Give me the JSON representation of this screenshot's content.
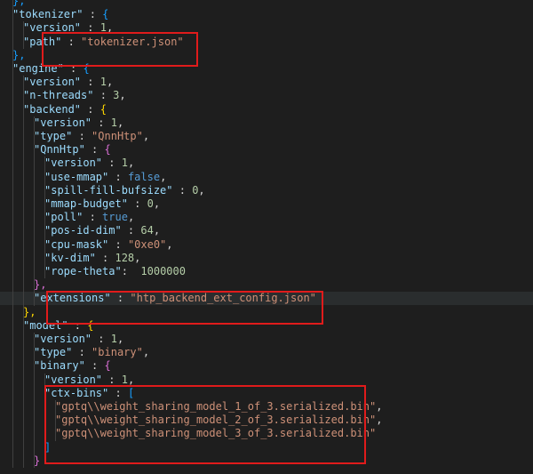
{
  "editor": {
    "lines": [
      {
        "indent": 2,
        "tokens": [
          [
            "p3",
            "},"
          ]
        ]
      },
      {
        "indent": 2,
        "tokens": [
          [
            "k",
            "\"tokenizer\""
          ],
          [
            "t",
            " : "
          ],
          [
            "p3",
            "{"
          ]
        ]
      },
      {
        "indent": 3,
        "tokens": [
          [
            "k",
            "\"version\""
          ],
          [
            "t",
            " : "
          ],
          [
            "n",
            "1"
          ],
          [
            "t",
            ","
          ]
        ]
      },
      {
        "indent": 3,
        "tokens": [
          [
            "k",
            "\"path\""
          ],
          [
            "t",
            " : "
          ],
          [
            "s",
            "\"tokenizer.json\""
          ]
        ]
      },
      {
        "indent": 2,
        "tokens": [
          [
            "p3",
            "},"
          ]
        ]
      },
      {
        "indent": 2,
        "tokens": [
          [
            "k",
            "\"engine\""
          ],
          [
            "t",
            " : "
          ],
          [
            "p3",
            "{"
          ]
        ]
      },
      {
        "indent": 3,
        "tokens": [
          [
            "k",
            "\"version\""
          ],
          [
            "t",
            " : "
          ],
          [
            "n",
            "1"
          ],
          [
            "t",
            ","
          ]
        ]
      },
      {
        "indent": 3,
        "tokens": [
          [
            "k",
            "\"n-threads\""
          ],
          [
            "t",
            " : "
          ],
          [
            "n",
            "3"
          ],
          [
            "t",
            ","
          ]
        ]
      },
      {
        "indent": 3,
        "tokens": [
          [
            "k",
            "\"backend\""
          ],
          [
            "t",
            " : "
          ],
          [
            "p1",
            "{"
          ]
        ]
      },
      {
        "indent": 4,
        "tokens": [
          [
            "k",
            "\"version\""
          ],
          [
            "t",
            " : "
          ],
          [
            "n",
            "1"
          ],
          [
            "t",
            ","
          ]
        ]
      },
      {
        "indent": 4,
        "tokens": [
          [
            "k",
            "\"type\""
          ],
          [
            "t",
            " : "
          ],
          [
            "s",
            "\"QnnHtp\""
          ],
          [
            "t",
            ","
          ]
        ]
      },
      {
        "indent": 4,
        "tokens": [
          [
            "k",
            "\"QnnHtp\""
          ],
          [
            "t",
            " : "
          ],
          [
            "p2",
            "{"
          ]
        ]
      },
      {
        "indent": 5,
        "tokens": [
          [
            "k",
            "\"version\""
          ],
          [
            "t",
            " : "
          ],
          [
            "n",
            "1"
          ],
          [
            "t",
            ","
          ]
        ]
      },
      {
        "indent": 5,
        "tokens": [
          [
            "k",
            "\"use-mmap\""
          ],
          [
            "t",
            " : "
          ],
          [
            "b",
            "false"
          ],
          [
            "t",
            ","
          ]
        ]
      },
      {
        "indent": 5,
        "tokens": [
          [
            "k",
            "\"spill-fill-bufsize\""
          ],
          [
            "t",
            " : "
          ],
          [
            "n",
            "0"
          ],
          [
            "t",
            ","
          ]
        ]
      },
      {
        "indent": 5,
        "tokens": [
          [
            "k",
            "\"mmap-budget\""
          ],
          [
            "t",
            " : "
          ],
          [
            "n",
            "0"
          ],
          [
            "t",
            ","
          ]
        ]
      },
      {
        "indent": 5,
        "tokens": [
          [
            "k",
            "\"poll\""
          ],
          [
            "t",
            " : "
          ],
          [
            "b",
            "true"
          ],
          [
            "t",
            ","
          ]
        ]
      },
      {
        "indent": 5,
        "tokens": [
          [
            "k",
            "\"pos-id-dim\""
          ],
          [
            "t",
            " : "
          ],
          [
            "n",
            "64"
          ],
          [
            "t",
            ","
          ]
        ]
      },
      {
        "indent": 5,
        "tokens": [
          [
            "k",
            "\"cpu-mask\""
          ],
          [
            "t",
            " : "
          ],
          [
            "s",
            "\"0xe0\""
          ],
          [
            "t",
            ","
          ]
        ]
      },
      {
        "indent": 5,
        "tokens": [
          [
            "k",
            "\"kv-dim\""
          ],
          [
            "t",
            " : "
          ],
          [
            "n",
            "128"
          ],
          [
            "t",
            ","
          ]
        ]
      },
      {
        "indent": 5,
        "tokens": [
          [
            "k",
            "\"rope-theta\""
          ],
          [
            "t",
            ":  "
          ],
          [
            "n",
            "1000000"
          ]
        ]
      },
      {
        "indent": 4,
        "tokens": [
          [
            "p2",
            "},"
          ]
        ]
      },
      {
        "indent": 4,
        "tokens": [
          [
            "k",
            "\"extensions\""
          ],
          [
            "t",
            " : "
          ],
          [
            "s",
            "\"htp_backend_ext_config.json\""
          ]
        ]
      },
      {
        "indent": 3,
        "tokens": [
          [
            "p1",
            "},"
          ]
        ]
      },
      {
        "indent": 3,
        "tokens": [
          [
            "k",
            "\"model\""
          ],
          [
            "t",
            " : "
          ],
          [
            "p1",
            "{"
          ]
        ]
      },
      {
        "indent": 4,
        "tokens": [
          [
            "k",
            "\"version\""
          ],
          [
            "t",
            " : "
          ],
          [
            "n",
            "1"
          ],
          [
            "t",
            ","
          ]
        ]
      },
      {
        "indent": 4,
        "tokens": [
          [
            "k",
            "\"type\""
          ],
          [
            "t",
            " : "
          ],
          [
            "s",
            "\"binary\""
          ],
          [
            "t",
            ","
          ]
        ]
      },
      {
        "indent": 4,
        "tokens": [
          [
            "k",
            "\"binary\""
          ],
          [
            "t",
            " : "
          ],
          [
            "p2",
            "{"
          ]
        ]
      },
      {
        "indent": 5,
        "tokens": [
          [
            "k",
            "\"version\""
          ],
          [
            "t",
            " : "
          ],
          [
            "n",
            "1"
          ],
          [
            "t",
            ","
          ]
        ]
      },
      {
        "indent": 5,
        "tokens": [
          [
            "k",
            "\"ctx-bins\""
          ],
          [
            "t",
            " : "
          ],
          [
            "p3",
            "["
          ]
        ]
      },
      {
        "indent": 6,
        "tokens": [
          [
            "s",
            "\"gptq\\\\weight_sharing_model_1_of_3.serialized.bin\""
          ],
          [
            "t",
            ","
          ]
        ]
      },
      {
        "indent": 6,
        "tokens": [
          [
            "s",
            "\"gptq\\\\weight_sharing_model_2_of_3.serialized.bin\""
          ],
          [
            "t",
            ","
          ]
        ]
      },
      {
        "indent": 6,
        "tokens": [
          [
            "s",
            "\"gptq\\\\weight_sharing_model_3_of_3.serialized.bin\""
          ]
        ]
      },
      {
        "indent": 5,
        "tokens": [
          [
            "p3",
            "]"
          ]
        ]
      },
      {
        "indent": 4,
        "tokens": [
          [
            "p2",
            "}"
          ]
        ]
      }
    ],
    "highlighted_line": 22,
    "annotations": [
      {
        "name": "path-annotation-box",
        "lines": [
          2,
          3
        ]
      },
      {
        "name": "extensions-annotation-box",
        "lines": [
          21,
          23
        ]
      },
      {
        "name": "ctx-bins-annotation-box",
        "lines": [
          28,
          33
        ]
      }
    ]
  }
}
